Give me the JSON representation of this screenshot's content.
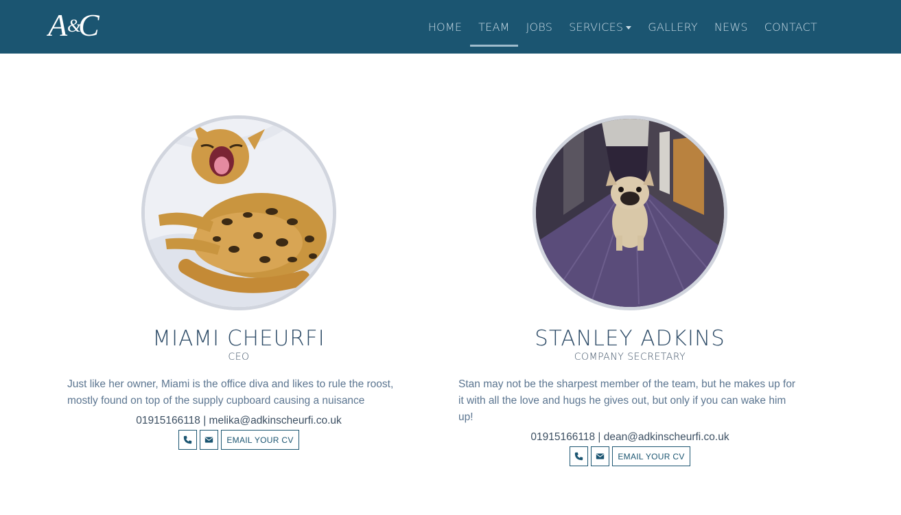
{
  "brand": {
    "logo_text": "A&C"
  },
  "nav": {
    "items": [
      {
        "label": "HOME"
      },
      {
        "label": "TEAM",
        "active": true
      },
      {
        "label": "JOBS"
      },
      {
        "label": "SERVICES",
        "dropdown": true
      },
      {
        "label": "GALLERY"
      },
      {
        "label": "NEWS"
      },
      {
        "label": "CONTACT"
      }
    ]
  },
  "team": [
    {
      "name": "MIAMI CHEURFI",
      "role": "CEO",
      "bio": "Just like her owner, Miami is the office diva and likes to rule the roost, mostly found on top of the supply cupboard causing a nuisance",
      "contact": "01915166118 | melika@adkinscheurfi.co.uk",
      "cv_label": "EMAIL YOUR CV",
      "photo": "bengal-cat-yawning"
    },
    {
      "name": "STANLEY ADKINS",
      "role": "COMPANY SECRETARY",
      "bio": "Stan may not be the sharpest member of the team, but he makes up for it with all the love and hugs he gives out, but only if you can wake him up!",
      "contact": "01915166118 | dean@adkinscheurfi.co.uk",
      "cv_label": "EMAIL YOUR CV",
      "photo": "french-bulldog-in-corridor"
    }
  ],
  "colors": {
    "navbar": "#1b5571",
    "accent": "#1b5571",
    "avatar_border": "#d1d5de"
  }
}
